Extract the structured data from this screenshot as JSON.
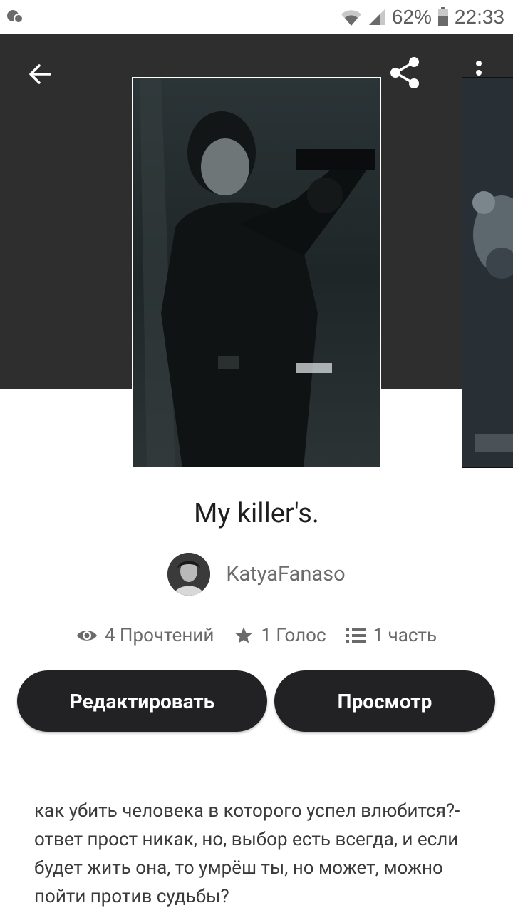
{
  "status_bar": {
    "battery_percent": "62%",
    "time": "22:33",
    "icons": [
      "notification-icon",
      "wifi-icon",
      "signal-icon",
      "battery-icon"
    ]
  },
  "header": {
    "icons": [
      "back-arrow-icon",
      "share-icon",
      "more-vert-icon"
    ]
  },
  "story": {
    "title": "My killer's.",
    "author": "KatyaFanaso",
    "stats": {
      "reads": "4 Прочтений",
      "votes": "1 Голос",
      "parts": "1 часть"
    },
    "description": "как убить человека в которого успел влюбится?-ответ прост никак, но, выбор есть всегда, и если будет жить она, то умрёш ты, но может, можно пойти против судьбы?"
  },
  "actions": {
    "edit_label": "Редактировать",
    "view_label": "Просмотр"
  },
  "colors": {
    "header_bg": "#2e2e2f",
    "button_bg": "#222123",
    "button_text": "#ffffff",
    "muted_text": "#6a6a6a"
  }
}
